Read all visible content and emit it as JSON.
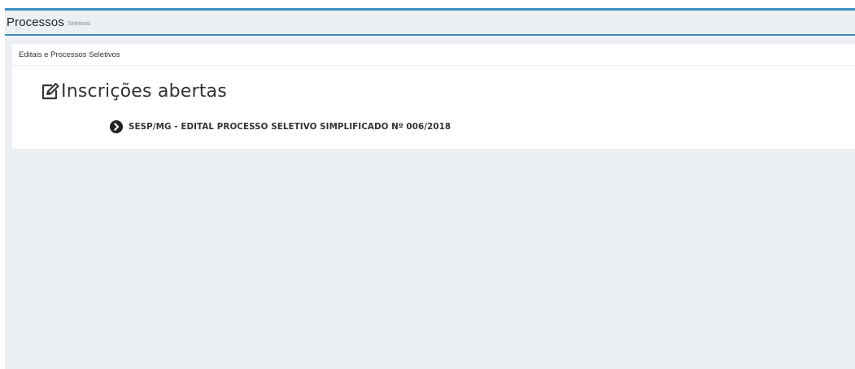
{
  "header": {
    "title": "Processos",
    "subtitle": "Seletivos"
  },
  "box": {
    "title": "Editais e Processos Seletivos",
    "section": {
      "title": "Inscrições abertas",
      "icon": "edit-icon"
    },
    "items": [
      {
        "label": "SESP/MG - EDITAL PROCESSO SELETIVO SIMPLIFICADO Nº 006/2018",
        "icon": "chevron-circle-right-icon"
      }
    ]
  },
  "colors": {
    "accent": "#3c8dbc",
    "background": "#ecf0f5",
    "text": "#333333"
  }
}
